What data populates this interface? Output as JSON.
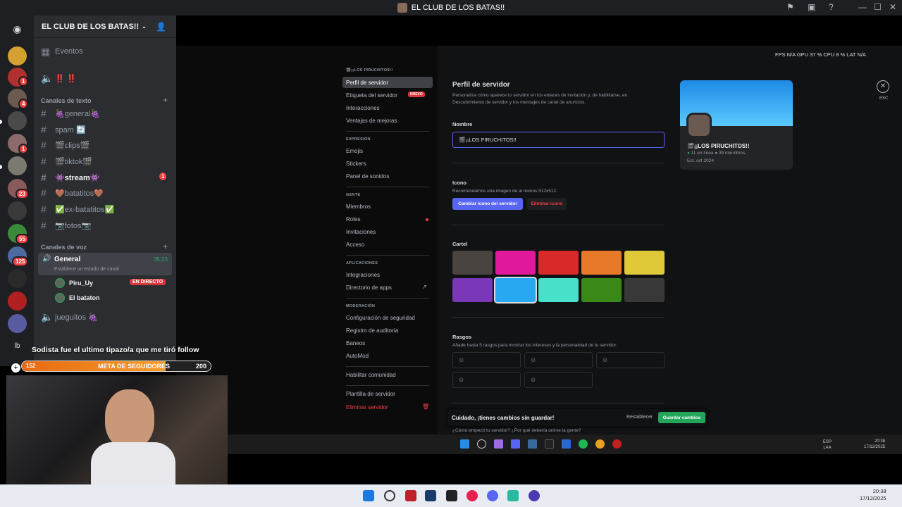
{
  "window": {
    "title": "EL CLUB DE LOS BATAS!!"
  },
  "server": {
    "name": "EL CLUB DE LOS BATAS!!"
  },
  "sidebar": {
    "events": "Eventos",
    "announce": "‼️ ‼️",
    "text_category": "Canales de texto",
    "text_channels": [
      "🍇general🍇",
      "spam 🔄",
      "🎬clips🎬",
      "🎬tiktok🎬",
      "👾stream👾",
      "🤎batatitos🤎",
      "✅ex-batatitos✅",
      "📷fotos📷"
    ],
    "stream_badge": "1",
    "voice_category": "Canales de voz",
    "voice_channel": "General",
    "voice_time": "35:23",
    "voice_status": "Establece un estado de canal",
    "voice_users": [
      "Piru_Uy",
      "El bataton"
    ],
    "live_label": "EN DIRECTO",
    "voice_channel2": "jueguitos 🍇"
  },
  "guild_badges": [
    "1",
    "4",
    "1",
    "23",
    "55",
    "125"
  ],
  "guild_last": "lb",
  "overlay": {
    "follow_text": "Sodista fue el ultimo tipazo/a que me tiró follow",
    "goal_label": "META DE SEGUIDORES",
    "goal_current": "152",
    "goal_target": "200",
    "goal_fraction": 0.76,
    "stats": "FPS  N/A    GPU  37 %    CPU  8 %    LAT  N/A"
  },
  "settings_nav": {
    "server_label": "🎬¡¡LOS PIRUCHITOS!!",
    "items_a": [
      "Perfil de servidor",
      "Etiqueta del servidor",
      "Interacciones",
      "Ventajas de mejoras"
    ],
    "new_tag": "NUEVO",
    "h_expr": "EXPRESIÓN",
    "items_b": [
      "Emojis",
      "Stickers",
      "Panel de sonidos"
    ],
    "h_people": "GENTE",
    "items_c": [
      "Miembros",
      "Roles",
      "Invitaciones",
      "Acceso"
    ],
    "h_apps": "APLICACIONES",
    "items_d": [
      "Integraciones",
      "Directorio de apps"
    ],
    "h_mod": "MODERACIÓN",
    "items_e": [
      "Configuración de seguridad",
      "Registro de auditoría",
      "Baneos",
      "AutoMod"
    ],
    "enable_community": "Habilitar comunidad",
    "template": "Plantilla de servidor",
    "delete": "Eliminar servidor"
  },
  "profile": {
    "title": "Perfil de servidor",
    "desc1": "Personaliza cómo aparece tu servidor en los enlaces de invitación y, de habilitarse, en",
    "desc2": "Descubrimiento de servidor y los mensajes de canal de anuncios.",
    "name_label": "Nombre",
    "name_value": "🎬¡¡LOS PIRUCHITOS!!",
    "icon_label": "Icono",
    "icon_desc": "Recomendamos una imagen de al menos 512x512.",
    "change_icon": "Cambiar icono del servidor",
    "remove_icon": "Eliminar icono",
    "banner_label": "Cartel",
    "banner_colors": [
      "#4a4440",
      "#e0189a",
      "#d82828",
      "#e8782a",
      "#e0c838",
      "#7a38b8",
      "#28a8f0",
      "#48e0c8",
      "#3a8818",
      "#383838"
    ],
    "traits_label": "Rasgos",
    "traits_desc": "Añade hasta 5 rasgos para mostrar los intereses y la personalidad de tu servidor.",
    "bottom_q": "¿Cómo empezó tu servidor? ¿Por qué debería unirse la gente?"
  },
  "preview": {
    "name": "🎬¡¡LOS PIRUCHITOS!!",
    "online": "11 en línea",
    "members": "39 miembros",
    "est": "Est. oct 2024"
  },
  "close_label": "ESC",
  "savebar": {
    "message": "Cuidado, ¡tienes cambios sin guardar!",
    "reset": "Restablecer",
    "save": "Guardar cambios"
  },
  "inner_tray": {
    "lang1": "ESP",
    "lang2": "LAA",
    "time": "20:38",
    "date": "17/12/2025"
  },
  "tray": {
    "time": "20:38",
    "date": "17/12/2025"
  }
}
